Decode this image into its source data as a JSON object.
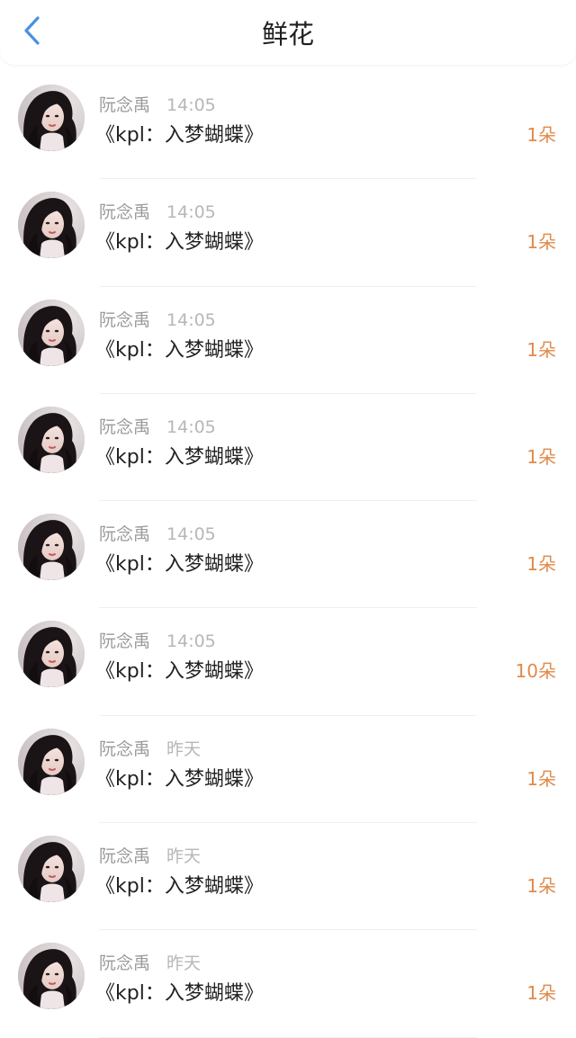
{
  "header": {
    "title": "鲜花",
    "back_icon": "chevron-left-icon",
    "accent_color": "#4a90e2"
  },
  "items": [
    {
      "name": "阮念禹",
      "time": "14:05",
      "song": "《kpl：入梦蝴蝶》",
      "count": "1朵"
    },
    {
      "name": "阮念禹",
      "time": "14:05",
      "song": "《kpl：入梦蝴蝶》",
      "count": "1朵"
    },
    {
      "name": "阮念禹",
      "time": "14:05",
      "song": "《kpl：入梦蝴蝶》",
      "count": "1朵"
    },
    {
      "name": "阮念禹",
      "time": "14:05",
      "song": "《kpl：入梦蝴蝶》",
      "count": "1朵"
    },
    {
      "name": "阮念禹",
      "time": "14:05",
      "song": "《kpl：入梦蝴蝶》",
      "count": "1朵"
    },
    {
      "name": "阮念禹",
      "time": "14:05",
      "song": "《kpl：入梦蝴蝶》",
      "count": "10朵"
    },
    {
      "name": "阮念禹",
      "time": "昨天",
      "song": "《kpl：入梦蝴蝶》",
      "count": "1朵"
    },
    {
      "name": "阮念禹",
      "time": "昨天",
      "song": "《kpl：入梦蝴蝶》",
      "count": "1朵"
    },
    {
      "name": "阮念禹",
      "time": "昨天",
      "song": "《kpl：入梦蝴蝶》",
      "count": "1朵"
    }
  ],
  "colors": {
    "count": "#e08a4a",
    "meta": "#9a9a9a",
    "divider": "#efefef"
  }
}
